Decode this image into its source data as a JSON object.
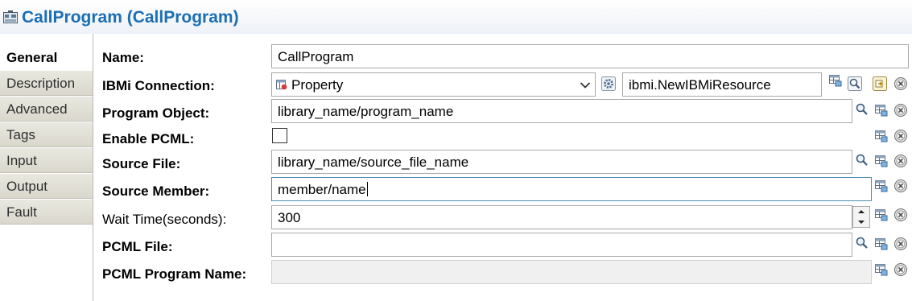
{
  "title": "CallProgram (CallProgram)",
  "tabs": [
    {
      "label": "General",
      "active": true
    },
    {
      "label": "Description",
      "active": false
    },
    {
      "label": "Advanced",
      "active": false
    },
    {
      "label": "Tags",
      "active": false
    },
    {
      "label": "Input",
      "active": false
    },
    {
      "label": "Output",
      "active": false
    },
    {
      "label": "Fault",
      "active": false
    }
  ],
  "form": {
    "name": {
      "label": "Name:",
      "value": "CallProgram"
    },
    "connection": {
      "label": "IBMi Connection:",
      "type_value": "Property",
      "resource_value": "ibmi.NewIBMiResource"
    },
    "program_object": {
      "label": "Program Object:",
      "value": "library_name/program_name"
    },
    "enable_pcml": {
      "label": "Enable PCML:",
      "checked": false
    },
    "source_file": {
      "label": "Source File:",
      "value": "library_name/source_file_name"
    },
    "source_member": {
      "label": "Source Member:",
      "value": "member/name"
    },
    "wait_time": {
      "label": "Wait Time(seconds):",
      "value": "300"
    },
    "pcml_file": {
      "label": "PCML File:",
      "value": ""
    },
    "pcml_program_name": {
      "label": "PCML Program Name:",
      "value": ""
    }
  },
  "icons": {
    "title": "ibmi-component-icon",
    "binding": "property-binding-icon",
    "search": "search-icon",
    "clear": "clear-icon",
    "edit": "edit-resource-icon",
    "gear": "gear-icon",
    "dropdown": "chevron-down-icon"
  },
  "colors": {
    "title": "#1a6fb5",
    "focus_border": "#4a8bb3"
  }
}
